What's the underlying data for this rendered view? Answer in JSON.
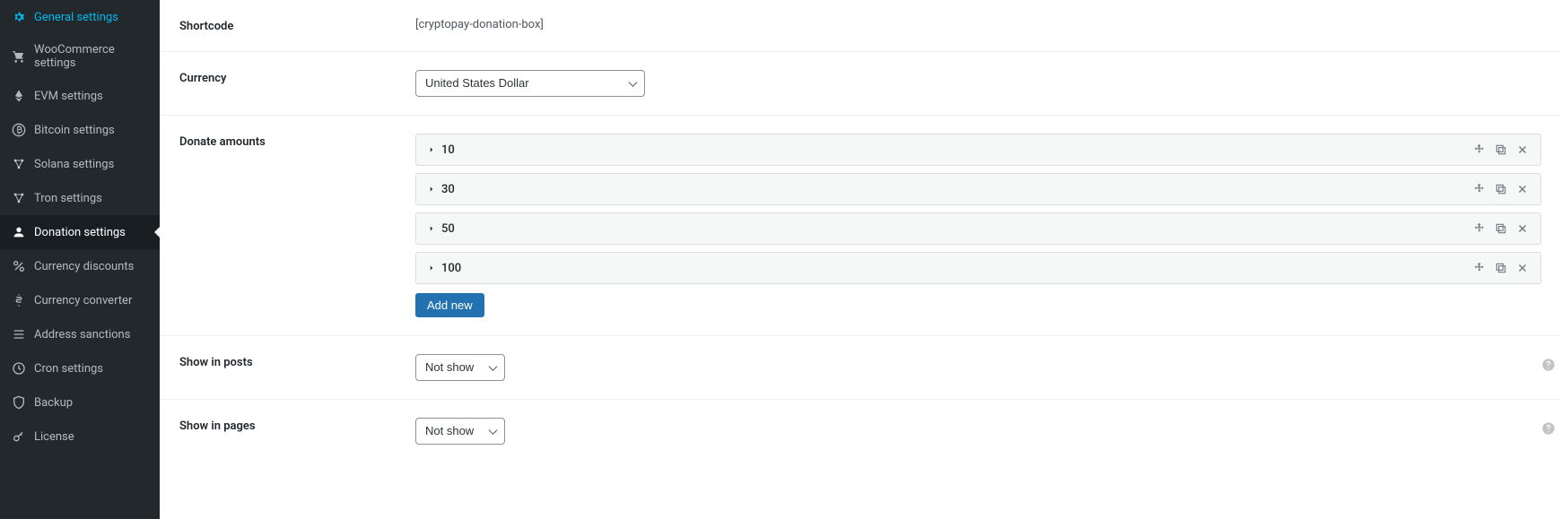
{
  "sidebar": {
    "items": [
      {
        "label": "General settings",
        "icon": "gear-icon"
      },
      {
        "label": "WooCommerce settings",
        "icon": "cart-icon"
      },
      {
        "label": "EVM settings",
        "icon": "eth-icon"
      },
      {
        "label": "Bitcoin settings",
        "icon": "bitcoin-icon"
      },
      {
        "label": "Solana settings",
        "icon": "network-icon"
      },
      {
        "label": "Tron settings",
        "icon": "network-icon"
      },
      {
        "label": "Donation settings",
        "icon": "donate-icon"
      },
      {
        "label": "Currency discounts",
        "icon": "percent-icon"
      },
      {
        "label": "Currency converter",
        "icon": "dollar-icon"
      },
      {
        "label": "Address sanctions",
        "icon": "list-icon"
      },
      {
        "label": "Cron settings",
        "icon": "clock-icon"
      },
      {
        "label": "Backup",
        "icon": "shield-icon"
      },
      {
        "label": "License",
        "icon": "key-icon"
      }
    ],
    "active_index": 6
  },
  "fields": {
    "shortcode": {
      "label": "Shortcode",
      "value": "[cryptopay-donation-box]"
    },
    "currency": {
      "label": "Currency",
      "selected": "United States Dollar"
    },
    "donate_amounts": {
      "label": "Donate amounts",
      "items": [
        "10",
        "30",
        "50",
        "100"
      ],
      "add_button": "Add new"
    },
    "show_in_posts": {
      "label": "Show in posts",
      "selected": "Not show"
    },
    "show_in_pages": {
      "label": "Show in pages",
      "selected": "Not show"
    }
  }
}
